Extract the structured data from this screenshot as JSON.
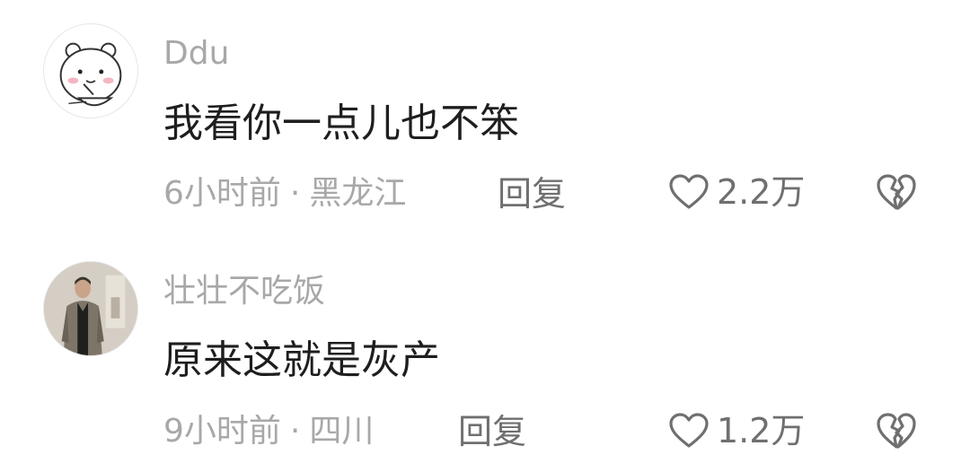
{
  "comments": [
    {
      "username": "Ddu",
      "content": "我看你一点儿也不笨",
      "time": "6小时前",
      "separator": "·",
      "location": "黑龙江",
      "reply_label": "回复",
      "like_count": "2.2万",
      "avatar_icon": "cartoon-bear-avatar",
      "like_icon": "heart-outline-icon",
      "dislike_icon": "broken-heart-icon"
    },
    {
      "username": "壮壮不吃饭",
      "content": "原来这就是灰产",
      "time": "9小时前",
      "separator": "·",
      "location": "四川",
      "reply_label": "回复",
      "like_count": "1.2万",
      "avatar_icon": "person-photo-avatar",
      "like_icon": "heart-outline-icon",
      "dislike_icon": "broken-heart-icon"
    }
  ],
  "colors": {
    "text_primary": "#1e1e1e",
    "text_secondary": "#a8a8a8",
    "text_action": "#6f6f6f",
    "background": "#ffffff"
  }
}
